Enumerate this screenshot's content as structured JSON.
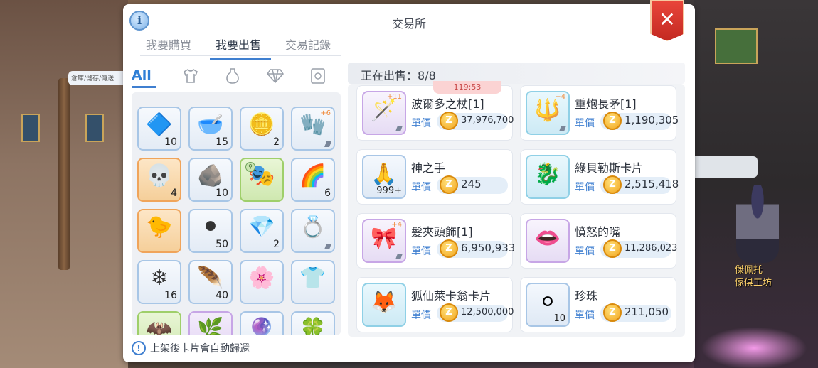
{
  "scene": {
    "left_sign": "倉庫/儲存/傳送",
    "right_npc_tag": "傑佩托",
    "right_npc_name_line1": "傑佩托",
    "right_npc_name_line2": "傢俱工坊"
  },
  "window": {
    "title": "交易所",
    "info_icon": "i",
    "close_icon": "✕"
  },
  "tabs": [
    {
      "label": "我要購買",
      "active": false
    },
    {
      "label": "我要出售",
      "active": true
    },
    {
      "label": "交易記錄",
      "active": false
    }
  ],
  "categories": [
    {
      "label": "All",
      "icon": "all-text",
      "active": true
    },
    {
      "label": "",
      "icon": "shirt-icon",
      "active": false
    },
    {
      "label": "",
      "icon": "potion-icon",
      "active": false
    },
    {
      "label": "",
      "icon": "gem-icon",
      "active": false
    },
    {
      "label": "",
      "icon": "card-icon",
      "active": false
    }
  ],
  "inventory": [
    {
      "name": "blue-crystal",
      "glyph": "🔷",
      "qty": "10",
      "frame": "blue"
    },
    {
      "name": "mortar-bowl",
      "glyph": "🥣",
      "qty": "15",
      "frame": "blue"
    },
    {
      "name": "golden-coins",
      "glyph": "🪙",
      "qty": "2",
      "frame": "blue"
    },
    {
      "name": "glove",
      "glyph": "🧤",
      "qty": "",
      "refine": "+6",
      "frame": "blue",
      "flag": true
    },
    {
      "name": "skull-mask",
      "glyph": "💀",
      "qty": "4",
      "frame": "orange"
    },
    {
      "name": "dark-ore",
      "glyph": "🪨",
      "qty": "10",
      "frame": "blue"
    },
    {
      "name": "masked-card",
      "glyph": "🎭",
      "qty": "",
      "frame": "green",
      "lock": true
    },
    {
      "name": "rainbow-gem",
      "glyph": "🌈",
      "qty": "6",
      "frame": "blue"
    },
    {
      "name": "rubber-duck",
      "glyph": "🐤",
      "qty": "",
      "frame": "orange"
    },
    {
      "name": "coal-lumps",
      "glyph": "⚫",
      "qty": "50",
      "frame": "blue"
    },
    {
      "name": "purple-crystal",
      "glyph": "💎",
      "qty": "2",
      "frame": "blue"
    },
    {
      "name": "gold-ring",
      "glyph": "💍",
      "qty": "",
      "frame": "blue",
      "flag": true
    },
    {
      "name": "ice-crystals",
      "glyph": "❄",
      "qty": "16",
      "frame": "blue"
    },
    {
      "name": "feather",
      "glyph": "🪶",
      "qty": "40",
      "frame": "blue"
    },
    {
      "name": "flower-wreath",
      "glyph": "🌸",
      "qty": "",
      "frame": "blue"
    },
    {
      "name": "green-shirt",
      "glyph": "👕",
      "qty": "",
      "frame": "blue"
    },
    {
      "name": "dark-item",
      "glyph": "🦇",
      "qty": "",
      "frame": "green"
    },
    {
      "name": "twig",
      "glyph": "🌿",
      "qty": "",
      "frame": "purple"
    },
    {
      "name": "crystal-ball",
      "glyph": "🔮",
      "qty": "",
      "frame": "blue"
    },
    {
      "name": "clover",
      "glyph": "🍀",
      "qty": "",
      "frame": "blue"
    }
  ],
  "footer_note": "上架後卡片會自動歸還",
  "selling_header": {
    "label": "正在出售：",
    "count": "8/8"
  },
  "timer": "119:53",
  "unit_label": "單價",
  "listings": [
    {
      "name": "波爾多之杖[1]",
      "price": "37,976,700",
      "glyph": "🪄",
      "refine": "+11",
      "frame": "purple",
      "qty": "",
      "flag": true
    },
    {
      "name": "重炮長矛[1]",
      "price": "1,190,305",
      "glyph": "🔱",
      "refine": "+4",
      "frame": "cyan",
      "qty": "",
      "flag": true
    },
    {
      "name": "神之手",
      "price": "245",
      "glyph": "🙏",
      "refine": "",
      "frame": "blue",
      "qty": "999+",
      "flag": false
    },
    {
      "name": "綠貝勒斯卡片",
      "price": "2,515,418",
      "glyph": "🐉",
      "refine": "",
      "frame": "cyan",
      "qty": "",
      "flag": false
    },
    {
      "name": "髮夾頭飾[1]",
      "price": "6,950,933",
      "glyph": "🎀",
      "refine": "+4",
      "frame": "purple",
      "qty": "",
      "flag": true
    },
    {
      "name": "憤怒的嘴",
      "price": "11,286,023",
      "glyph": "👄",
      "refine": "",
      "frame": "purple",
      "qty": "",
      "flag": false
    },
    {
      "name": "狐仙萊卡翁卡片",
      "price": "12,500,000",
      "glyph": "🦊",
      "refine": "",
      "frame": "cyan",
      "qty": "",
      "flag": false
    },
    {
      "name": "珍珠",
      "price": "211,050",
      "glyph": "⚪",
      "refine": "",
      "frame": "blue",
      "qty": "10",
      "flag": false
    }
  ],
  "coin_symbol": "Z"
}
